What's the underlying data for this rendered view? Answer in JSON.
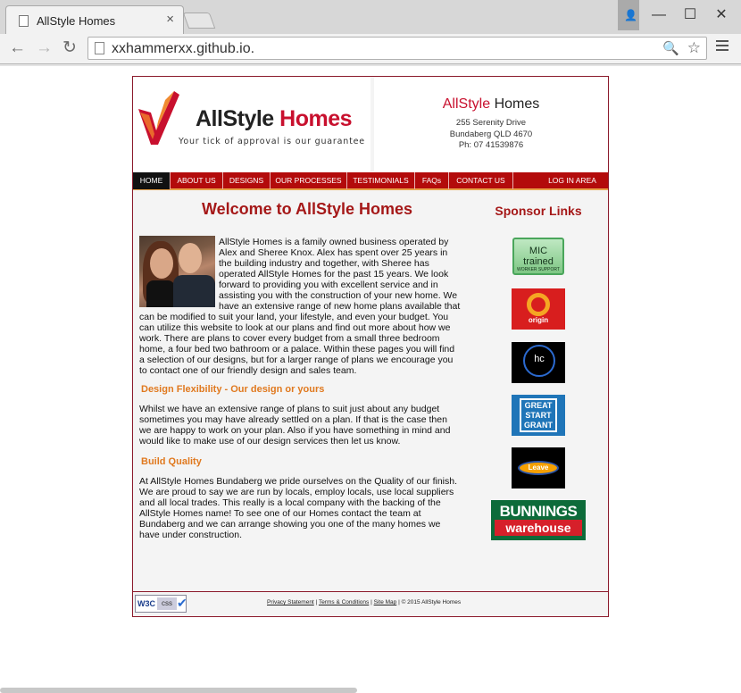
{
  "browser": {
    "tab_title": "AllStyle Homes",
    "tab_close": "×",
    "url": "xxhammerxx.github.io.",
    "controls": {
      "minimize": "—",
      "maximize": "☐",
      "close": "✕"
    }
  },
  "site": {
    "logo": {
      "word1": "AllStyle",
      "word2": "Homes",
      "tagline": "Your tick of approval is our guarantee"
    },
    "contact": {
      "name_red": "AllStyle",
      "name_black": "Homes",
      "street": "255 Serenity Drive",
      "city": "Bundaberg QLD 4670",
      "phone": "Ph: 07 41539876"
    },
    "nav": {
      "home": "HOME",
      "about": "ABOUT US",
      "designs": "DESIGNS",
      "processes": "OUR PROCESSES",
      "testimonials": "TESTIMONIALS",
      "faqs": "FAQs",
      "contact": "CONTACT US",
      "login": "LOG IN AREA"
    },
    "welcome_title": "Welcome to AllStyle Homes",
    "sponsor_title": "Sponsor Links",
    "intro_lines": [
      "AllStyle Homes is a family owned business operated by",
      "Alex and Sheree Knox. Alex has spent over 25 years in",
      "the building industry and together, with Sheree has",
      "operated AllStyle Homes for the past 15 years. We look",
      "forward to providing you with excellent service and in",
      "assisting you with the construction of your new home. We",
      "have an extensive range of new home plans available that"
    ],
    "intro_full_lines": [
      "can be modified to suit your land, your lifestyle, and even your budget. You",
      "can utilize this website to look at our plans and find out more about how we",
      "work. There are plans to cover every budget from a small three bedroom",
      "home, a four bed two bathroom or a palace. Within these pages you will find",
      "a selection of our designs, but for a larger range of plans we encourage you",
      "to contact one of our friendly design and sales team."
    ],
    "section1_title": "Design Flexibility - Our design or yours",
    "section1_lines": [
      "Whilst we have an extensive range of plans to suit just about any budget",
      "sometimes you may have already settled on a plan. If that is the case then",
      "we are happy to work on your plan. Also if you have something in mind and",
      "would like to make use of our design services then let us know."
    ],
    "section2_title": "Build Quality",
    "section2_lines": [
      "At AllStyle Homes Bundaberg we pride ourselves on the Quality of our finish.",
      "We are proud to say we are run by locals, employ locals, use local suppliers",
      "and all local trades. This really is a local company with the backing of the",
      "AllStyle Homes name! To see one of our Homes contact the team at",
      "Bundaberg and we can arrange showing you one of the many homes we",
      "have under construction."
    ],
    "sponsors": {
      "mic_line1": "MIC trained",
      "mic_line2": "WORKER SUPPORT",
      "origin": "origin",
      "hc": "hc",
      "gsg": [
        "GREAT",
        "START",
        "GRANT"
      ],
      "leave": "Leave",
      "bunnings1": "BUNNINGS",
      "bunnings2": "warehouse"
    },
    "footer": {
      "w3c": "W3C",
      "css": "css",
      "privacy": "Privacy Statement",
      "terms": "Terms & Conditions",
      "sitemap": "Site Map",
      "copyright": "© 2015 AllStyle Homes"
    }
  }
}
